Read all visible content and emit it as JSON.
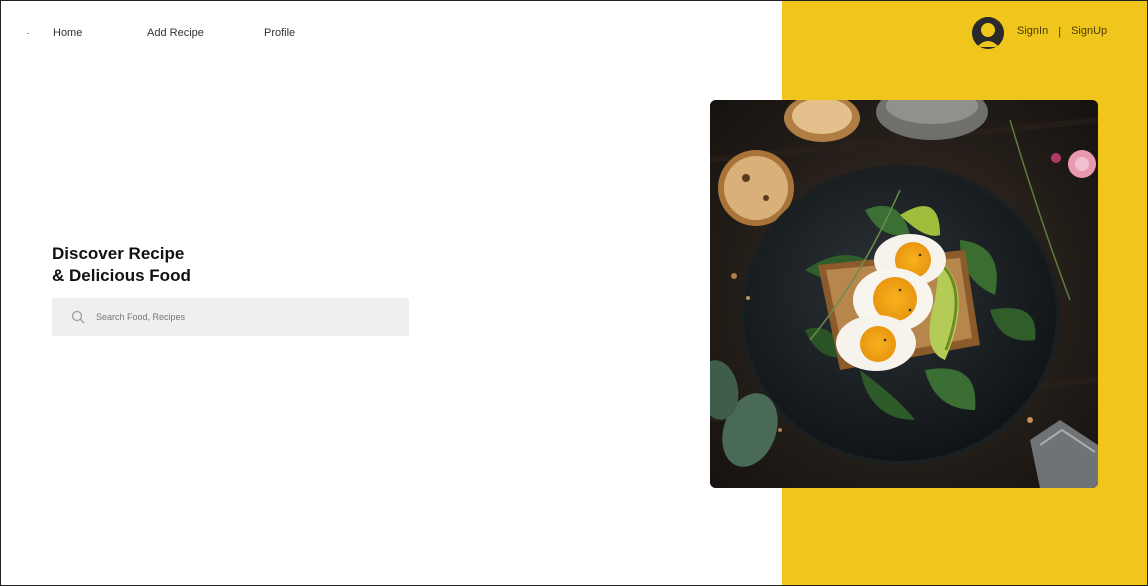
{
  "nav": {
    "items": [
      {
        "label": "Home"
      },
      {
        "label": "Add Recipe"
      },
      {
        "label": "Profile"
      }
    ]
  },
  "auth": {
    "signin_label": "SignIn",
    "separator": "|",
    "signup_label": "SignUp",
    "avatar_icon": "user-avatar-icon"
  },
  "hero": {
    "title_line1": "Discover Recipe",
    "title_line2": "& Delicious Food"
  },
  "search": {
    "placeholder": "Search Food, Recipes",
    "value": "",
    "icon": "search-icon"
  },
  "colors": {
    "accent": "#f0c61d",
    "text": "#111111",
    "search_bg": "#efefef"
  }
}
